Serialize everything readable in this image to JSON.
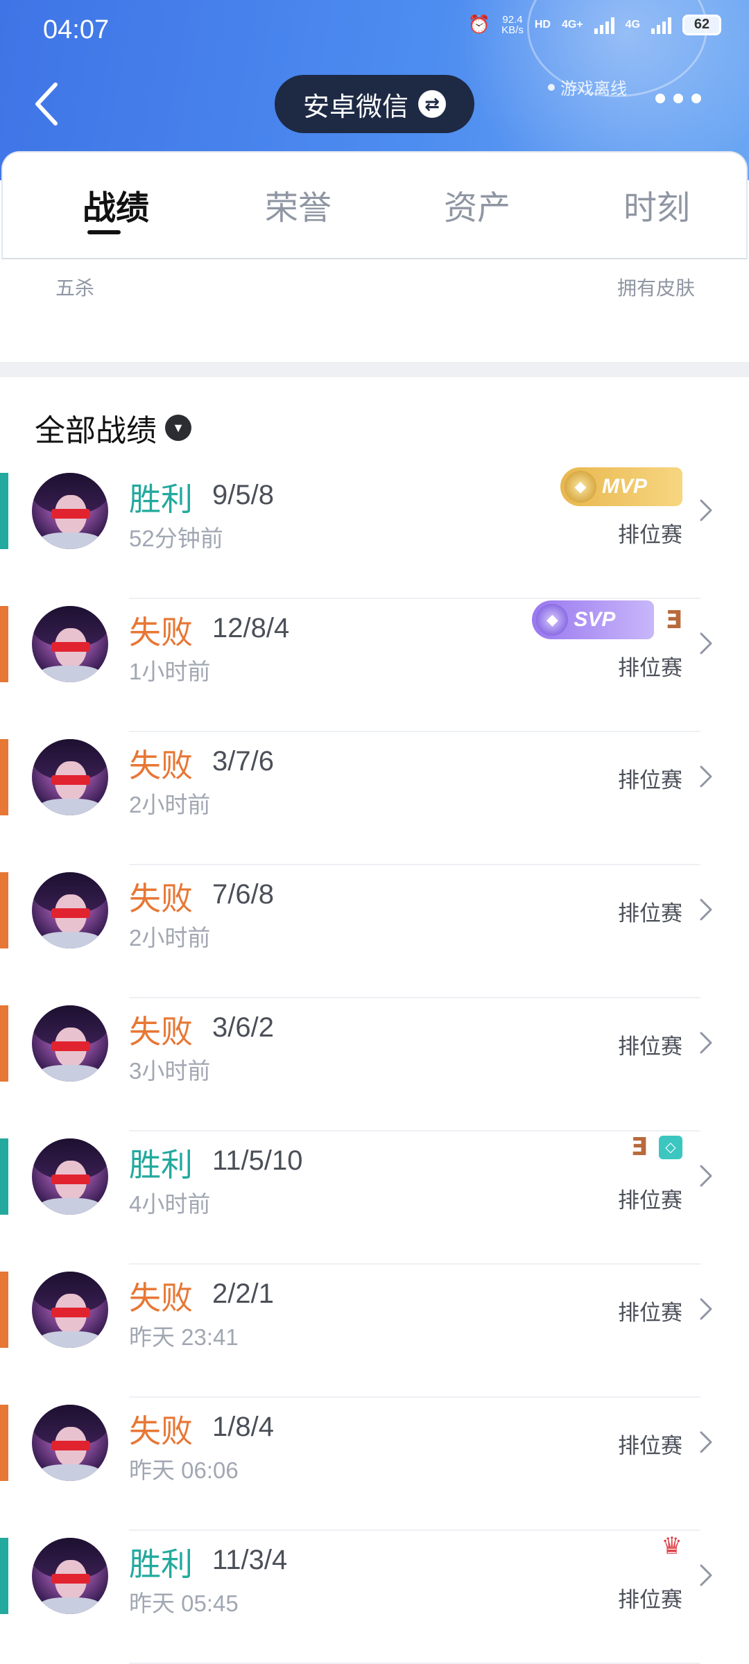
{
  "status_bar": {
    "time": "04:07",
    "net_speed": "92.4",
    "net_unit": "KB/s",
    "hd_label": "HD",
    "sig1_label": "4G+",
    "sig2_label": "4G",
    "battery": "62"
  },
  "header": {
    "account_label": "安卓微信",
    "status_text": "游戏离线"
  },
  "tabs": [
    {
      "label": "战绩",
      "active": true
    },
    {
      "label": "荣誉",
      "active": false
    },
    {
      "label": "资产",
      "active": false
    },
    {
      "label": "时刻",
      "active": false
    }
  ],
  "stats": {
    "left_label": "五杀",
    "right_label": "拥有皮肤"
  },
  "section": {
    "title": "全部战绩"
  },
  "matches": [
    {
      "result": "胜利",
      "kda": "9/5/8",
      "time": "52分钟前",
      "mode": "排位赛",
      "badge": "MVP"
    },
    {
      "result": "失败",
      "kda": "12/8/4",
      "time": "1小时前",
      "mode": "排位赛",
      "badge": "SVP"
    },
    {
      "result": "失败",
      "kda": "3/7/6",
      "time": "2小时前",
      "mode": "排位赛",
      "badge": ""
    },
    {
      "result": "失败",
      "kda": "7/6/8",
      "time": "2小时前",
      "mode": "排位赛",
      "badge": ""
    },
    {
      "result": "失败",
      "kda": "3/6/2",
      "time": "3小时前",
      "mode": "排位赛",
      "badge": ""
    },
    {
      "result": "胜利",
      "kda": "11/5/10",
      "time": "4小时前",
      "mode": "排位赛",
      "badge": ""
    },
    {
      "result": "失败",
      "kda": "2/2/1",
      "time": "昨天  23:41",
      "mode": "排位赛",
      "badge": ""
    },
    {
      "result": "失败",
      "kda": "1/8/4",
      "time": "昨天  06:06",
      "mode": "排位赛",
      "badge": ""
    },
    {
      "result": "胜利",
      "kda": "11/3/4",
      "time": "昨天  05:45",
      "mode": "排位赛",
      "badge": ""
    }
  ],
  "colors": {
    "win": "#23a99d",
    "loss": "#e77735",
    "header_blue": "#4d8cf0"
  },
  "icons": {
    "back": "chevron-left-icon",
    "switch": "switch-arrows-icon",
    "more": "more-dots-icon",
    "dropdown": "chevron-down-icon",
    "row_arrow": "chevron-right-icon"
  }
}
